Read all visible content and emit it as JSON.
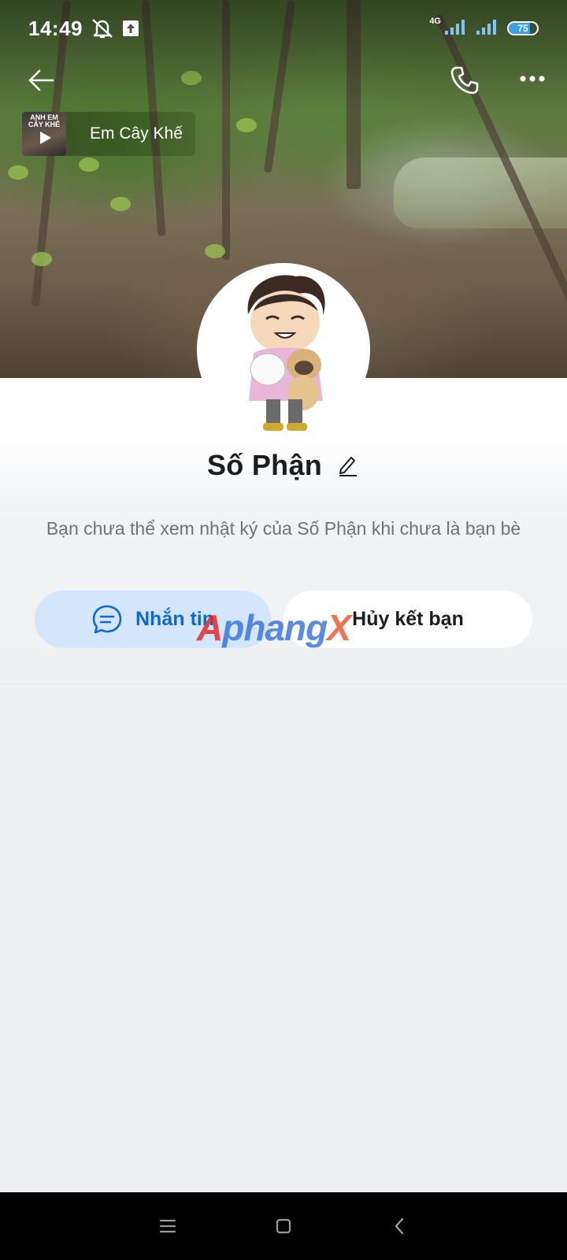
{
  "status_bar": {
    "time": "14:49",
    "network": "4G",
    "battery": "75",
    "battery_level": 0.75
  },
  "header": {
    "back_icon": "arrow-left-icon",
    "call_icon": "phone-icon",
    "more_icon": "more-dots-icon"
  },
  "music": {
    "album_text": "ANH EM CÂY KHẾ",
    "title": "Em Cây Khế"
  },
  "profile": {
    "name": "Số Phận",
    "privacy_note": "Bạn chưa thể xem nhật ký của Số Phận khi chưa là bạn bè"
  },
  "actions": {
    "message_label": "Nhắn tin",
    "unfriend_label": "Hủy kết bạn"
  },
  "watermark": {
    "part1": "A",
    "part2": "phang",
    "part3": "X"
  },
  "colors": {
    "accent": "#1068d0",
    "message_bg": "#d3e6fb",
    "page_bg": "#eef0f2"
  }
}
